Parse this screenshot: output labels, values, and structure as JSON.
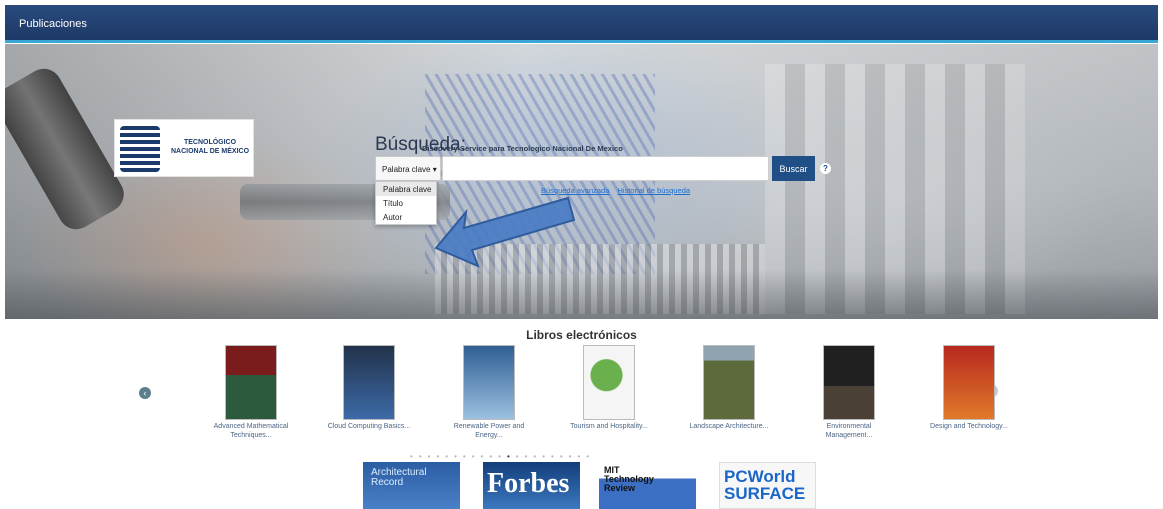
{
  "header": {
    "title": "Publicaciones"
  },
  "logo": {
    "text": "TECNOLÓGICO NACIONAL DE MÉXICO"
  },
  "search": {
    "title": "Búsqueda:",
    "subtitle": "Discovery Service para Tecnologico Nacional De Mexico",
    "field_selected": "Palabra clave ▾",
    "options": [
      "Palabra clave",
      "Título",
      "Autor"
    ],
    "button": "Buscar",
    "help": "?",
    "links": [
      "Búsqueda avanzada",
      "Historial de búsqueda"
    ]
  },
  "ebooks": {
    "title": "Libros electrónicos",
    "items": [
      {
        "title": "Advanced Mathematical Techniques...",
        "color": "#7a1c1c"
      },
      {
        "title": "Cloud Computing Basics...",
        "color": "#22324a"
      },
      {
        "title": "Renewable Power and Energy...",
        "color": "#2f5f93"
      },
      {
        "title": "Tourism and Hospitality...",
        "color": "#f2f2f2"
      },
      {
        "title": "Landscape Architecture...",
        "color": "#5d6b3c"
      },
      {
        "title": "Environmental Management...",
        "color": "#202020"
      },
      {
        "title": "Design and Technology...",
        "color": "#b8281f"
      }
    ]
  },
  "magazines": [
    {
      "name": "Architectural Record",
      "color": "#2c5da3"
    },
    {
      "name": "Forbes",
      "color": "#1f5da8"
    },
    {
      "name": "MIT Technology Review",
      "color": "#3b6fc4"
    },
    {
      "name": "PCWorld SURFACE",
      "color": "#f7f7f7"
    }
  ],
  "carousel": {
    "prev_icon": "chevron-left-icon",
    "next_icon": "chevron-right-icon"
  }
}
